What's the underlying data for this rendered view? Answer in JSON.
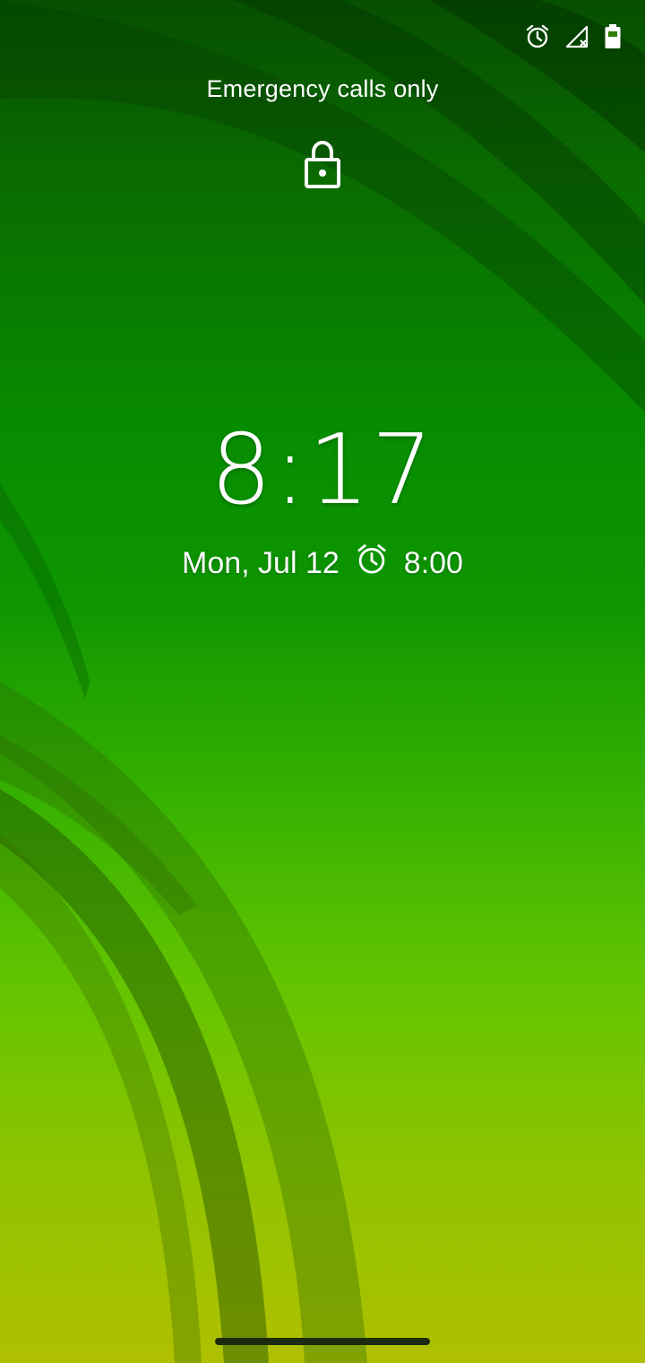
{
  "status_bar": {
    "icons": [
      "alarm-icon",
      "signal-off-icon",
      "battery-icon"
    ]
  },
  "lockscreen": {
    "carrier_text": "Emergency calls only",
    "lock_icon": "lock-icon",
    "clock_time": "8:17",
    "date": "Mon, Jul 12",
    "next_alarm_icon": "alarm-icon",
    "next_alarm": "8:00"
  },
  "colors": {
    "wallpaper_top": "#064f00",
    "wallpaper_mid": "#0e9600",
    "wallpaper_bottom": "#b0c000",
    "text": "#ffffff"
  }
}
